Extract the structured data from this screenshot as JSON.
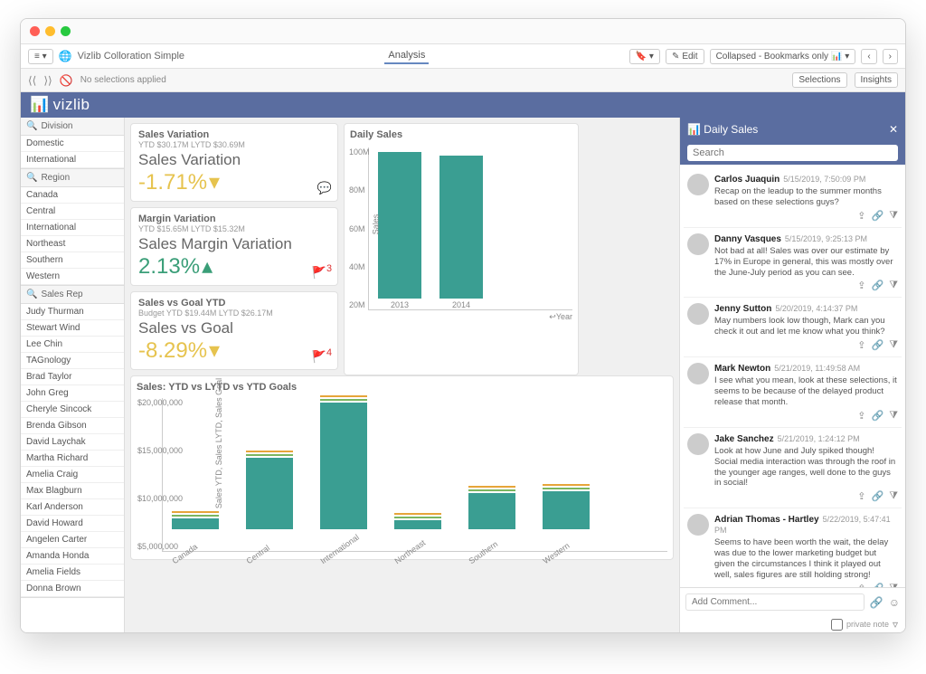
{
  "app_name": "Vizlib Colloration Simple",
  "active_tab": "Analysis",
  "toolbar": {
    "edit": "Edit",
    "bookmarks": "Collapsed - Bookmarks only"
  },
  "selections_bar": {
    "none": "No selections applied",
    "sel_btn": "Selections",
    "insights_btn": "Insights"
  },
  "brand": "vizlib",
  "sidebar": {
    "division": {
      "head": "Division",
      "items": [
        "Domestic",
        "International"
      ]
    },
    "region": {
      "head": "Region",
      "items": [
        "Canada",
        "Central",
        "International",
        "Northeast",
        "Southern",
        "Western"
      ]
    },
    "rep": {
      "head": "Sales Rep",
      "items": [
        "Judy Thurman",
        "Stewart Wind",
        "Lee Chin",
        "TAGnology",
        "Brad Taylor",
        "John Greg",
        "Cheryle Sincock",
        "Brenda Gibson",
        "David Laychak",
        "Martha Richard",
        "Amelia Craig",
        "Max Blagburn",
        "Karl Anderson",
        "David Howard",
        "Angelen Carter",
        "Amanda Honda",
        "Amelia Fields",
        "Donna Brown"
      ]
    }
  },
  "metrics": {
    "variation": {
      "title": "Sales Variation",
      "sub": "YTD $30.17M LYTD $30.69M",
      "label": "Sales Variation",
      "value": "-1.71%",
      "dir": "neg"
    },
    "margin": {
      "title": "Margin Variation",
      "sub": "YTD $15.65M LYTD $15.32M",
      "label": "Sales Margin Variation",
      "value": "2.13%",
      "dir": "pos",
      "badge": "3"
    },
    "goal": {
      "title": "Sales vs Goal YTD",
      "sub": "Budget YTD $19.44M LYTD $26.17M",
      "label": "Sales vs Goal",
      "value": "-8.29%",
      "dir": "neg",
      "badge": "4"
    }
  },
  "chart1": {
    "title": "Daily Sales",
    "xtitle": "Year"
  },
  "chart2": {
    "title": "Sales: YTD vs LYTD vs YTD Goals",
    "ytitle": "Sales YTD, Sales LYTD, Sales Goal"
  },
  "comments_panel": {
    "title": "Daily Sales",
    "search_placeholder": "Search",
    "items": [
      {
        "name": "Carlos Juaquin",
        "time": "5/15/2019, 7:50:09 PM",
        "text": "Recap on the leadup to the summer months based on these selections guys?"
      },
      {
        "name": "Danny Vasques",
        "time": "5/15/2019, 9:25:13 PM",
        "text": "Not bad at all! Sales was over our estimate by 17% in Europe in general, this was mostly over the June-July period as you can see."
      },
      {
        "name": "Jenny Sutton",
        "time": "5/20/2019, 4:14:37 PM",
        "text": "May numbers look low though, Mark can you check it out and let me know what you think?"
      },
      {
        "name": "Mark Newton",
        "time": "5/21/2019, 11:49:58 AM",
        "text": "I see what you mean, look at these selections, it seems to be because of the delayed product release that month."
      },
      {
        "name": "Jake Sanchez",
        "time": "5/21/2019, 1:24:12 PM",
        "text": "Look at how June and July spiked though! Social media interaction was through the roof in the younger age ranges, well done to the guys in social!"
      },
      {
        "name": "Adrian Thomas - Hartley",
        "time": "5/22/2019, 5:47:41 PM",
        "text": "Seems to have been worth the wait, the delay was due to the lower marketing budget but given the circumstances I think it played out well, sales figures are still holding strong!"
      }
    ],
    "add_placeholder": "Add Comment...",
    "private": "private note"
  },
  "chart_data": [
    {
      "type": "bar",
      "title": "Daily Sales",
      "xlabel": "Year",
      "ylabel": "Sales",
      "ylim": [
        0,
        100000000
      ],
      "yticks": [
        "20M",
        "40M",
        "60M",
        "80M",
        "100M"
      ],
      "categories": [
        "2013",
        "2014"
      ],
      "values": [
        90000000,
        88000000
      ]
    },
    {
      "type": "bar",
      "title": "Sales: YTD vs LYTD vs YTD Goals",
      "ylabel": "Sales YTD, Sales LYTD, Sales Goal",
      "ylim": [
        0,
        20000000
      ],
      "yticks": [
        "$5,000,000",
        "$10,000,000",
        "$15,000,000",
        "$20,000,000"
      ],
      "categories": [
        "Canada",
        "Central",
        "International",
        "Northeast",
        "Southern",
        "Western"
      ],
      "series": [
        {
          "name": "Sales YTD",
          "values": [
            1400000,
            9300000,
            16500000,
            1200000,
            4700000,
            4900000
          ]
        },
        {
          "name": "Sales LYTD",
          "values": [
            1900000,
            11000000,
            14500000,
            1700000,
            4300000,
            5100000
          ]
        },
        {
          "name": "Sales Goal",
          "values": [
            2100000,
            11800000,
            14000000,
            1900000,
            4000000,
            5300000
          ]
        }
      ]
    }
  ]
}
